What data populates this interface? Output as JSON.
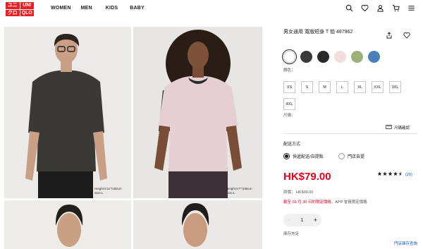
{
  "header": {
    "logo": [
      "ユニ",
      "UNI",
      "クロ",
      "QLO"
    ],
    "nav": [
      "WOMEN",
      "MEN",
      "KIDS",
      "BABY"
    ],
    "icons": [
      "search-icon",
      "heart-icon",
      "user-icon",
      "cart-icon",
      "menu-icon"
    ]
  },
  "gallery": {
    "photo1_caption": [
      "Height:5'11\"/180cm",
      "Size:L"
    ],
    "photo2_caption": [
      "Height:5'7\"/168cm",
      "Size:L"
    ]
  },
  "product": {
    "title": "男女通用 寬版短身 T 恤 487962",
    "colors": [
      "#ffffff",
      "#3a3a3a",
      "#2a2a2a",
      "#f2dde0",
      "#9eb07a",
      "#4a7fb8"
    ],
    "selected_color_index": 0,
    "color_label": "顏色：",
    "sizes": [
      "XS",
      "S",
      "M",
      "L",
      "XL",
      "XXL",
      "3XL",
      "4XL"
    ],
    "size_label": "尺碼：",
    "size_guide": "尺碼確認",
    "shipping_label": "配送方式",
    "shipping_options": [
      "快遞配送/自提點",
      "門店自提"
    ],
    "selected_shipping_index": 0,
    "price": "HK$79.00",
    "rating_stars": 4.5,
    "rating_count": "(29)",
    "original_price": "原價： HK$99.00",
    "promo_highlight": "截至 09 月 30 日的限定價格",
    "promo_rest": "，APP 會員限定價格",
    "quantity": "1",
    "stock_status": "庫存充足",
    "store_stock_link": "門店庫存查詢"
  }
}
